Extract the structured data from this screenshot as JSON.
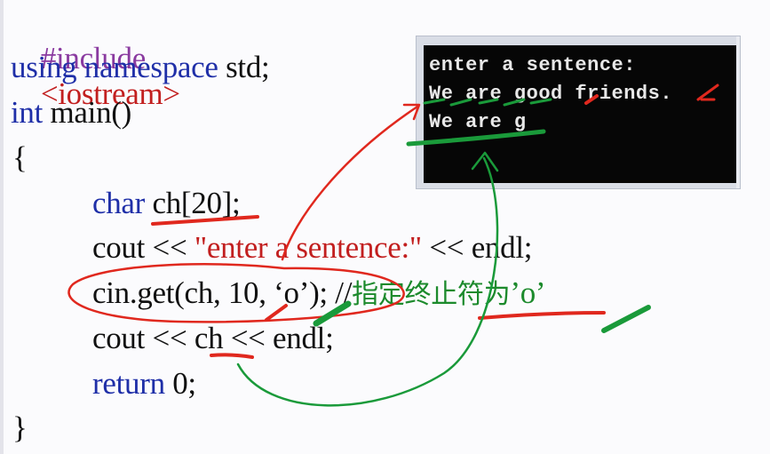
{
  "code": {
    "l1_include": "#include",
    "l1_header": "<iostream>",
    "l2_using": "using namespace",
    "l2_std": " std;",
    "l3_int": "int",
    "l3_main": " main()",
    "l4": "{",
    "l5_char": "char",
    "l5_decl": " ch[20];",
    "l6_cout": "cout << ",
    "l6_str": "\"enter a sentence:\"",
    "l6_end": " << endl;",
    "l7_call": "cin.get(ch, 10, ‘o’); //",
    "l7_comment": "指定终止符为",
    "l7_tail": "’o’",
    "l8": "cout << ch << endl;",
    "l9_return": "return",
    "l9_val": " 0;",
    "l10": "}"
  },
  "console": {
    "line1": "enter a sentence:",
    "line2": "We are good friends.",
    "line3": "We are g"
  },
  "colors": {
    "keyword": "#1f2fa8",
    "string": "#c21f1f",
    "comment": "#1c8a2c",
    "annotation_red": "#e0281e",
    "annotation_green": "#1a9a3a"
  }
}
